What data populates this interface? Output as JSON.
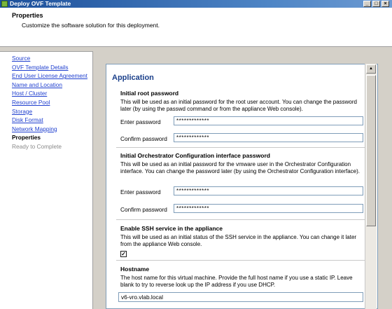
{
  "window": {
    "title": "Deploy OVF Template"
  },
  "header": {
    "title": "Properties",
    "subtitle": "Customize the software solution for this deployment."
  },
  "nav": {
    "items": [
      {
        "label": "Source",
        "state": "link"
      },
      {
        "label": "OVF Template Details",
        "state": "link"
      },
      {
        "label": "End User License Agreement",
        "state": "link"
      },
      {
        "label": "Name and Location",
        "state": "link"
      },
      {
        "label": "Host / Cluster",
        "state": "link"
      },
      {
        "label": "Resource Pool",
        "state": "link"
      },
      {
        "label": "Storage",
        "state": "link"
      },
      {
        "label": "Disk Format",
        "state": "link"
      },
      {
        "label": "Network Mapping",
        "state": "link"
      },
      {
        "label": "Properties",
        "state": "current"
      },
      {
        "label": "Ready to Complete",
        "state": "pending"
      }
    ]
  },
  "form": {
    "section_title": "Application",
    "root_password": {
      "title": "Initial root password",
      "description": "This will be used as an initial password for the root user account. You can change the password later (by using the passwd command or from the appliance Web console).",
      "enter_label": "Enter password",
      "enter_value": "*************",
      "confirm_label": "Confirm password",
      "confirm_value": "*************"
    },
    "orchestrator_password": {
      "title": "Initial Orchestrator Configuration interface password",
      "description": "This will be used as an initial password for the vmware user in the Orchestrator Configuration interface. You can change the password later (by using the Orchestrator Configuration interface).",
      "enter_label": "Enter password",
      "enter_value": "*************",
      "confirm_label": "Confirm password",
      "confirm_value": "*************"
    },
    "ssh": {
      "title": "Enable SSH service in the appliance",
      "description": "This will be used as an initial status of the SSH service in the appliance. You can change it later from the appliance Web console.",
      "checked": true,
      "check_glyph": "✓"
    },
    "hostname": {
      "title": "Hostname",
      "description": "The host name for this virtual machine. Provide the full host name if you use a static IP. Leave blank to try to reverse look up the IP address if you use DHCP.",
      "value": "v6-vro.vlab.local"
    }
  }
}
